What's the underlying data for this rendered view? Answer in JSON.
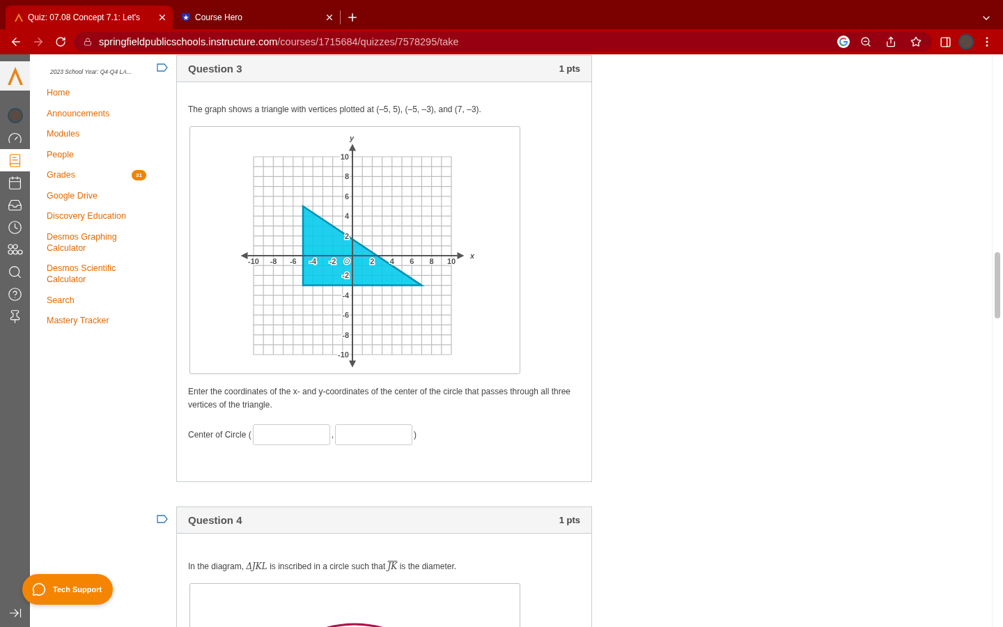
{
  "browser": {
    "tabs": [
      {
        "kind": "canvas",
        "title": "Quiz: 07.08 Concept 7.1: Let's",
        "selected": true
      },
      {
        "kind": "coursehero",
        "title": "Course Hero",
        "selected": false
      }
    ],
    "forward_disabled": true,
    "url": {
      "host": "springfieldpublicschools.instructure.com",
      "path": "/courses/1715684/quizzes/7578295/take"
    }
  },
  "rail": [
    {
      "kind": "account",
      "selected": false
    },
    {
      "kind": "dashboard",
      "selected": false
    },
    {
      "kind": "courses",
      "selected": true
    },
    {
      "kind": "calendar",
      "selected": false
    },
    {
      "kind": "inbox",
      "selected": false
    },
    {
      "kind": "history",
      "selected": false
    },
    {
      "kind": "groups",
      "selected": false
    },
    {
      "kind": "search",
      "selected": false
    },
    {
      "kind": "help",
      "selected": false
    },
    {
      "kind": "pin",
      "selected": false
    }
  ],
  "course_nav": {
    "title": "2023 School Year: Q4-Q4 LA...",
    "items": [
      {
        "label": "Home"
      },
      {
        "label": "Announcements"
      },
      {
        "label": "Modules"
      },
      {
        "label": "People"
      },
      {
        "label": "Grades",
        "badge": "31"
      },
      {
        "label": "Google Drive"
      },
      {
        "label": "Discovery Education"
      },
      {
        "label": "Desmos Graphing Calculator"
      },
      {
        "label": "Desmos Scientific Calculator"
      },
      {
        "label": "Search"
      },
      {
        "label": "Mastery Tracker"
      }
    ]
  },
  "questions": [
    {
      "title": "Question 3",
      "points": "1 pts",
      "flagged": false,
      "blocks": [
        {
          "kind": "text",
          "text": "The graph shows a triangle with vertices plotted at (–5, 5), (–5, –3), and (7, –3)."
        },
        {
          "kind": "graph",
          "x_axis_label": "x",
          "y_axis_label": "y",
          "origin_label": "O",
          "x_tick_labels": [
            "-10",
            "-8",
            "-6",
            "-4",
            "-2",
            "2",
            "4",
            "6",
            "8",
            "10"
          ],
          "y_tick_labels": [
            "10",
            "8",
            "6",
            "4",
            "2",
            "-2",
            "-4",
            "-6",
            "-8",
            "-10"
          ]
        },
        {
          "kind": "text",
          "text": "Enter the coordinates of the x- and y-coordinates of the center of the circle that passes through all three vertices of the triangle."
        },
        {
          "kind": "answer",
          "label": "Center of Circle (",
          "separator": ",",
          "closing": ")",
          "fields": [
            {
              "kind": "text"
            },
            {
              "kind": "text"
            }
          ]
        }
      ]
    },
    {
      "title": "Question 4",
      "points": "1 pts",
      "flagged": false,
      "blocks": [
        {
          "kind": "math-text",
          "parts": [
            {
              "kind": "plain",
              "text": "In the diagram, "
            },
            {
              "kind": "math",
              "text": "ΔJKL"
            },
            {
              "kind": "plain",
              "text": " is inscribed in a circle such that "
            },
            {
              "kind": "overline",
              "text": "JK"
            },
            {
              "kind": "plain",
              "text": " is the diameter."
            }
          ]
        },
        {
          "kind": "circle-figure"
        }
      ]
    }
  ],
  "support_button": {
    "label": "Tech Support"
  }
}
